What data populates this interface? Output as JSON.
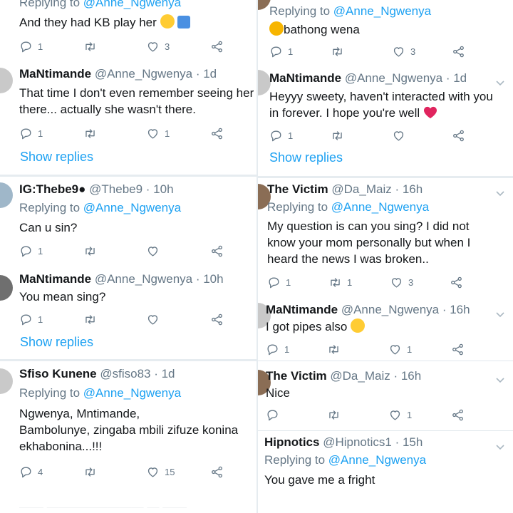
{
  "left": {
    "t1": {
      "reply_prefix": "Replying to ",
      "reply_mention": "@Anne_Ngwenya",
      "body": "And they had KB play her",
      "reply_count": "1",
      "like_count": "3"
    },
    "t2": {
      "name": "MaNtimande",
      "handle": "@Anne_Ngwenya",
      "time": "· 1d",
      "body": "That time I don't even remember seeing her there... actually she wasn't there.",
      "reply_count": "1",
      "like_count": "1",
      "show_replies": "Show replies"
    },
    "t3": {
      "name": "IG:Thebe9●",
      "handle": "@Thebe9",
      "time": "· 10h",
      "reply_prefix": "Replying to ",
      "reply_mention": "@Anne_Ngwenya",
      "body": "Can u sin?",
      "reply_count": "1"
    },
    "t4": {
      "name": "MaNtimande",
      "handle": "@Anne_Ngwenya",
      "time": "· 10h",
      "body": "You mean sing?",
      "reply_count": "1",
      "show_replies": "Show replies"
    },
    "t5": {
      "name": "Sfiso Kunene",
      "handle": "@sfiso83",
      "time": "· 1d",
      "reply_prefix": "Replying to ",
      "reply_mention": "@Anne_Ngwenya",
      "body_line1": "Ngwenya, Mntimande,",
      "body_line2": "Bambolunye, zingaba mbili zifuze konina",
      "body_line3": "ekhabonina...!!!",
      "reply_count": "4",
      "like_count": "15"
    }
  },
  "right": {
    "t1": {
      "reply_prefix": "Replying to ",
      "reply_mention": "@Anne_Ngwenya",
      "body": "bathong wena",
      "reply_count": "1",
      "like_count": "3"
    },
    "t2": {
      "name": "MaNtimande",
      "handle": "@Anne_Ngwenya",
      "time": "· 1d",
      "body_line1": "Heyyy sweety, haven't interacted with you",
      "body_line2": "in forever. I hope you're well",
      "reply_count": "1",
      "show_replies": "Show replies"
    },
    "t3": {
      "name": "The Victim",
      "handle": "@Da_Maiz",
      "time": "· 16h",
      "reply_prefix": "Replying to ",
      "reply_mention": "@Anne_Ngwenya",
      "body_line1": "My question is can you sing? I did not",
      "body_line2": "know your mom personally but when I",
      "body_line3": "heard the news I was broken..",
      "reply_count": "1",
      "retweet_count": "1",
      "like_count": "3"
    },
    "t4": {
      "name": "MaNtimande",
      "handle": "@Anne_Ngwenya",
      "time": "· 16h",
      "body": "I got pipes also",
      "reply_count": "1",
      "like_count": "1"
    },
    "t5": {
      "name": "The Victim",
      "handle": "@Da_Maiz",
      "time": "· 16h",
      "body": "Nice",
      "like_count": "1"
    },
    "t6": {
      "name": "Hipnotics",
      "handle": "@Hipnotics1",
      "time": "· 15h",
      "reply_prefix": "Replying to ",
      "reply_mention": "@Anne_Ngwenya",
      "body": "You gave me a fright"
    }
  },
  "colors": {
    "accent": "#1da1f2",
    "muted": "#657786",
    "heart": "#e0245e"
  }
}
